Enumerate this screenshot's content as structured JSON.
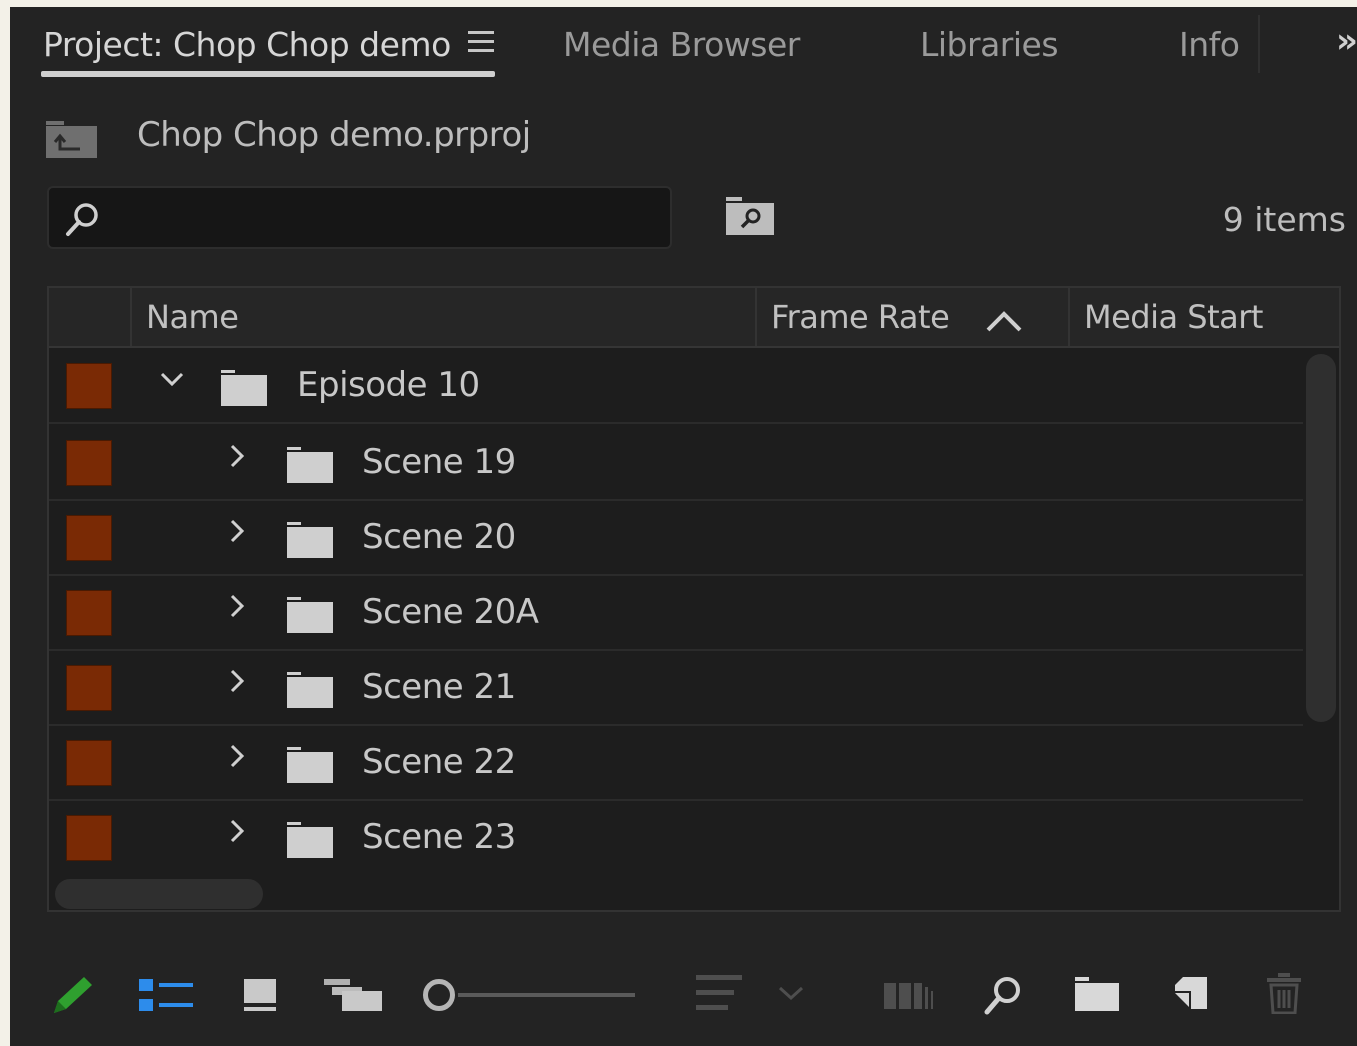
{
  "tabs": [
    {
      "label": "Project: Chop Chop demo",
      "active": true
    },
    {
      "label": "Media Browser",
      "active": false
    },
    {
      "label": "Libraries",
      "active": false
    },
    {
      "label": "Info",
      "active": false
    }
  ],
  "overflow_glyph": "»",
  "project": {
    "file_name": "Chop Chop demo.prproj"
  },
  "search": {
    "value": "",
    "placeholder": ""
  },
  "item_count": "9 items",
  "columns": [
    "Name",
    "Frame Rate",
    "Media Start"
  ],
  "sort": {
    "column": "Frame Rate",
    "direction": "ascending"
  },
  "rows": [
    {
      "name": "Episode 10",
      "expanded": true,
      "level": 0,
      "label_color": "#7a2a05"
    },
    {
      "name": "Scene 19",
      "expanded": false,
      "level": 1,
      "label_color": "#7a2a05"
    },
    {
      "name": "Scene 20",
      "expanded": false,
      "level": 1,
      "label_color": "#7a2a05"
    },
    {
      "name": "Scene 20A",
      "expanded": false,
      "level": 1,
      "label_color": "#7a2a05"
    },
    {
      "name": "Scene 21",
      "expanded": false,
      "level": 1,
      "label_color": "#7a2a05"
    },
    {
      "name": "Scene 22",
      "expanded": false,
      "level": 1,
      "label_color": "#7a2a05"
    },
    {
      "name": "Scene 23",
      "expanded": false,
      "level": 1,
      "label_color": "#7a2a05"
    }
  ],
  "toolbar": {
    "icons": [
      "pencil-icon",
      "list-view-icon",
      "icon-view-icon",
      "freeform-view-icon",
      "zoom-slider",
      "sort-icons-icon",
      "sort-dropdown-icon",
      "automate-to-sequence-icon",
      "find-icon",
      "new-bin-icon",
      "new-item-icon",
      "trash-icon"
    ],
    "zoom_level": 0.0
  },
  "colors": {
    "panel_bg": "#232323",
    "label_orange": "#7a2a05",
    "pencil_green": "#2fa02f",
    "list_view_blue": "#2d8ceb"
  }
}
